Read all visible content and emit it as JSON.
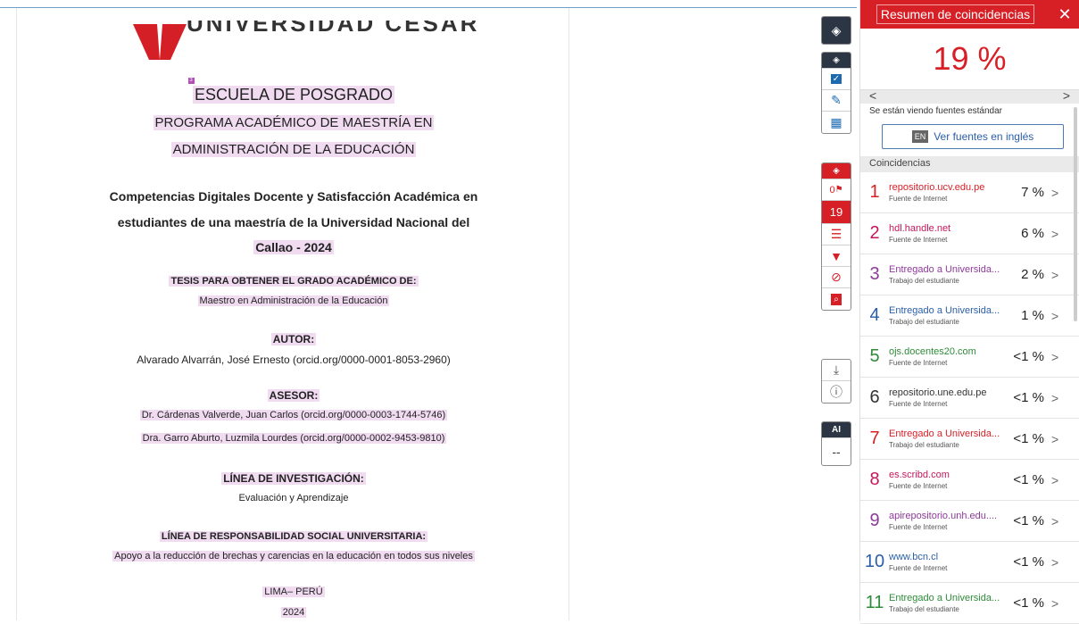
{
  "document": {
    "escuela": "ESCUELA DE POSGRADO",
    "programa_1": "PROGRAMA ACADÉMICO DE MAESTRÍA EN",
    "programa_2": "ADMINISTRACIÓN DE LA EDUCACIÓN",
    "title_1": "Competencias Digitales Docente y Satisfacción Académica en",
    "title_2": "estudiantes de una maestría de la Universidad Nacional del",
    "title_3": "Callao - 2024",
    "tesis_label": "TESIS PARA OBTENER EL GRADO ACADÉMICO DE:",
    "grado": "Maestro en Administración de la Educación",
    "autor_label": "AUTOR:",
    "autor": "Alvarado Alvarrán, José Ernesto (orcid.org/0000-0001-8053-2960)",
    "asesor_label": "ASESOR:",
    "asesor_1": "Dr. Cárdenas Valverde, Juan Carlos (orcid.org/0000-0003-1744-5746)",
    "asesor_2": "Dra. Garro Aburto, Luzmila Lourdes (orcid.org/0000-0002-9453-9810)",
    "linea_label": "LÍNEA DE INVESTIGACIÓN:",
    "linea": "Evaluación y Aprendizaje",
    "rsu_label": "LÍNEA DE RESPONSABILIDAD SOCIAL UNIVERSITARIA:",
    "rsu": "Apoyo a la reducción de brechas y carencias en la educación en todos sus niveles",
    "lugar": "LIMA– PERÚ",
    "anio": "2024",
    "header_cut": "UNIVERSIDAD CÉSAR VALLEJO"
  },
  "toolbar": {
    "match_count": "19",
    "ai_label": "AI",
    "ai_value": "--",
    "flag_value": "0"
  },
  "panel": {
    "title": "Resumen de coincidencias",
    "close": "✕",
    "percent": "19 %",
    "nav_left": "<",
    "nav_right": ">",
    "standard_text": "Se están viendo fuentes estándar",
    "en_badge": "EN",
    "en_button": "Ver fuentes en inglés",
    "coincidencias": "Coincidencias",
    "rows": [
      {
        "num": "1",
        "source": "repositorio.ucv.edu.pe",
        "type": "Fuente de Internet",
        "pct": "7 %",
        "color": "#d71f26"
      },
      {
        "num": "2",
        "source": "hdl.handle.net",
        "type": "Fuente de Internet",
        "pct": "6 %",
        "color": "#c2185b"
      },
      {
        "num": "3",
        "source": "Entregado a Universida...",
        "type": "Trabajo del estudiante",
        "pct": "2 %",
        "color": "#8e3a9a"
      },
      {
        "num": "4",
        "source": "Entregado a Universida...",
        "type": "Trabajo del estudiante",
        "pct": "1 %",
        "color": "#2a5ea8"
      },
      {
        "num": "5",
        "source": "ojs.docentes20.com",
        "type": "Fuente de Internet",
        "pct": "<1 %",
        "color": "#2e8b3a"
      },
      {
        "num": "6",
        "source": "repositorio.une.edu.pe",
        "type": "Fuente de Internet",
        "pct": "<1 %",
        "color": "#333333"
      },
      {
        "num": "7",
        "source": "Entregado a Universida...",
        "type": "Trabajo del estudiante",
        "pct": "<1 %",
        "color": "#d71f26"
      },
      {
        "num": "8",
        "source": "es.scribd.com",
        "type": "Fuente de Internet",
        "pct": "<1 %",
        "color": "#c2185b"
      },
      {
        "num": "9",
        "source": "apirepositorio.unh.edu....",
        "type": "Fuente de Internet",
        "pct": "<1 %",
        "color": "#8e3a9a"
      },
      {
        "num": "10",
        "source": "www.bcn.cl",
        "type": "Fuente de Internet",
        "pct": "<1 %",
        "color": "#2a5ea8"
      },
      {
        "num": "11",
        "source": "Entregado a Universida...",
        "type": "Trabajo del estudiante",
        "pct": "<1 %",
        "color": "#2e8b3a"
      }
    ],
    "arrow": ">"
  }
}
